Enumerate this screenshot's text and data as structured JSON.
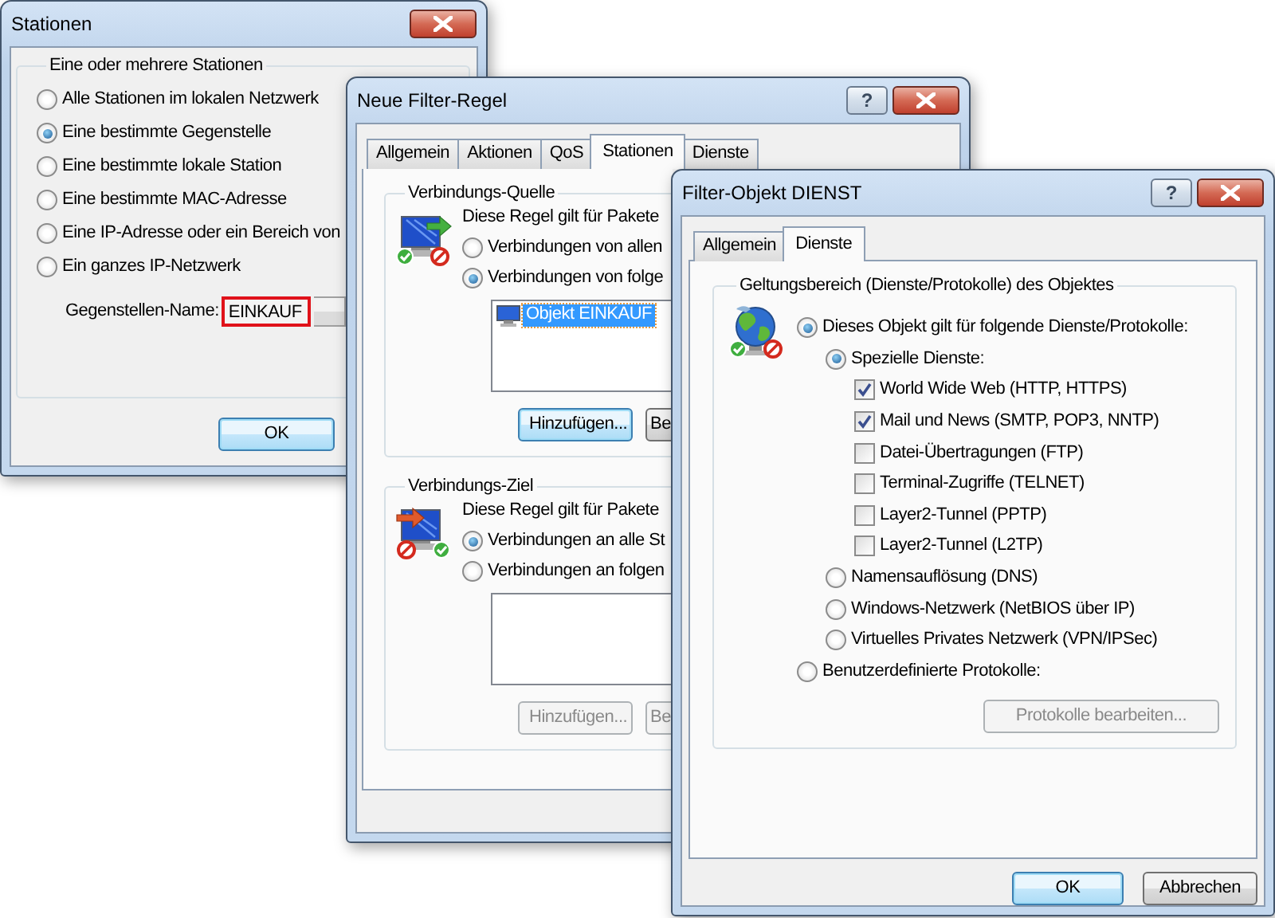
{
  "stations_dialog": {
    "title": "Stationen",
    "group_title": "Eine oder mehrere Stationen",
    "options": [
      {
        "label": "Alle Stationen im lokalen Netzwerk",
        "selected": false
      },
      {
        "label": "Eine bestimmte Gegenstelle",
        "selected": true
      },
      {
        "label": "Eine bestimmte lokale Station",
        "selected": false
      },
      {
        "label": "Eine bestimmte MAC-Adresse",
        "selected": false
      },
      {
        "label": "Eine IP-Adresse oder ein Bereich von",
        "selected": false
      },
      {
        "label": "Ein ganzes IP-Netzwerk",
        "selected": false
      }
    ],
    "name_field": {
      "label": "Gegenstellen-Name:",
      "value": "EINKAUF",
      "highlighted": true
    },
    "buttons": [
      {
        "label": "OK",
        "default": true
      }
    ]
  },
  "filter_rule_dialog": {
    "title": "Neue Filter-Regel",
    "help": "?",
    "tabs": [
      {
        "label": "Allgemein",
        "selected": false
      },
      {
        "label": "Aktionen",
        "selected": false
      },
      {
        "label": "QoS",
        "selected": false
      },
      {
        "label": "Stationen",
        "selected": true
      },
      {
        "label": "Dienste",
        "selected": false
      }
    ],
    "sections": [
      {
        "kind": "source",
        "title": "Verbindungs-Quelle",
        "text": "Diese Regel gilt für Pakete",
        "options": [
          {
            "label": "Verbindungen von allen",
            "selected": false
          },
          {
            "label": "Verbindungen von folge",
            "selected": true
          }
        ],
        "list_items": [
          {
            "label": "Objekt EINKAUF",
            "selected": true
          }
        ],
        "buttons": [
          {
            "label": "Hinzufügen...",
            "disabled": false,
            "default": true
          },
          {
            "label": "Be",
            "disabled": false,
            "default": false
          }
        ]
      },
      {
        "kind": "destination",
        "title": "Verbindungs-Ziel",
        "text": "Diese Regel gilt für Pakete",
        "options": [
          {
            "label": "Verbindungen an alle St",
            "selected": true
          },
          {
            "label": "Verbindungen an folgen",
            "selected": false
          }
        ],
        "buttons": [
          {
            "label": "Hinzufügen...",
            "disabled": true
          },
          {
            "label": "Be",
            "disabled": true
          }
        ]
      }
    ]
  },
  "filter_object_dialog": {
    "title": "Filter-Objekt DIENST",
    "help": "?",
    "tabs": [
      {
        "label": "Allgemein",
        "selected": false
      },
      {
        "label": "Dienste",
        "selected": true
      }
    ],
    "group_title": "Geltungsbereich (Dienste/Protokolle) des Objektes",
    "options": [
      {
        "kind": "radio",
        "label": "Dieses Objekt gilt für folgende Dienste/Protokolle:",
        "selected": true,
        "children": [
          {
            "kind": "radio",
            "label": "Spezielle Dienste:",
            "selected": true,
            "children": [
              {
                "kind": "checkbox",
                "label": "World Wide Web (HTTP, HTTPS)",
                "checked": true
              },
              {
                "kind": "checkbox",
                "label": "Mail und News (SMTP, POP3, NNTP)",
                "checked": true
              },
              {
                "kind": "checkbox",
                "label": "Datei-Übertragungen (FTP)",
                "checked": false
              },
              {
                "kind": "checkbox",
                "label": "Terminal-Zugriffe (TELNET)",
                "checked": false
              },
              {
                "kind": "checkbox",
                "label": "Layer2-Tunnel (PPTP)",
                "checked": false
              },
              {
                "kind": "checkbox",
                "label": "Layer2-Tunnel (L2TP)",
                "checked": false
              }
            ]
          },
          {
            "kind": "radio",
            "label": "Namensauflösung (DNS)",
            "selected": false
          },
          {
            "kind": "radio",
            "label": "Windows-Netzwerk (NetBIOS über IP)",
            "selected": false
          },
          {
            "kind": "radio",
            "label": "Virtuelles Privates Netzwerk (VPN/IPSec)",
            "selected": false
          }
        ]
      },
      {
        "kind": "radio",
        "label": "Benutzerdefinierte Protokolle:",
        "selected": false
      }
    ],
    "edit_button": {
      "label": "Protokolle bearbeiten...",
      "disabled": true
    },
    "buttons": [
      {
        "label": "OK",
        "default": true
      },
      {
        "label": "Abbrechen",
        "default": false
      }
    ]
  }
}
